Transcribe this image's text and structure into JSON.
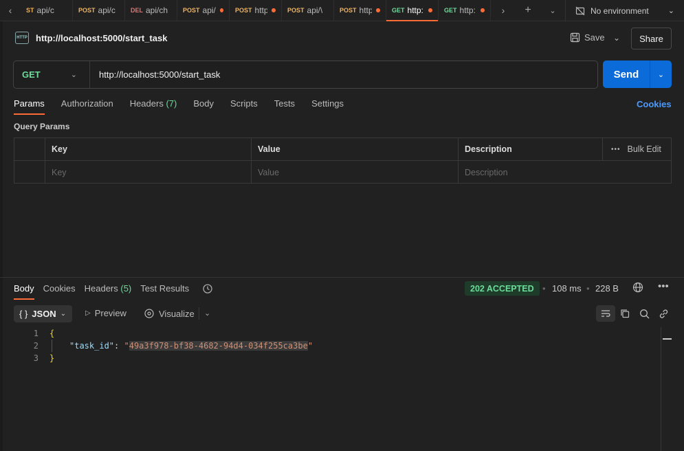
{
  "tabs": [
    {
      "method": "ST",
      "label": "api/c",
      "dot": false,
      "method_class": "m-post"
    },
    {
      "method": "POST",
      "label": "api/c",
      "dot": false,
      "method_class": "m-post"
    },
    {
      "method": "DEL",
      "label": "api/ch",
      "dot": false,
      "method_class": "m-del"
    },
    {
      "method": "POST",
      "label": "api/.",
      "dot": true,
      "method_class": "m-post"
    },
    {
      "method": "POST",
      "label": "http",
      "dot": true,
      "method_class": "m-post"
    },
    {
      "method": "POST",
      "label": "api/\\",
      "dot": false,
      "method_class": "m-post"
    },
    {
      "method": "POST",
      "label": "http",
      "dot": true,
      "method_class": "m-post"
    },
    {
      "method": "GET",
      "label": "http:,",
      "dot": true,
      "method_class": "m-get",
      "active": true
    },
    {
      "method": "GET",
      "label": "http:,",
      "dot": true,
      "method_class": "m-get"
    }
  ],
  "environment": {
    "label": "No environment"
  },
  "request": {
    "title": "http://localhost:5000/start_task",
    "save_label": "Save",
    "share_label": "Share",
    "method": "GET",
    "url": "http://localhost:5000/start_task",
    "send_label": "Send"
  },
  "request_tabs": {
    "params": "Params",
    "authorization": "Authorization",
    "headers": "Headers",
    "headers_count": "(7)",
    "body": "Body",
    "scripts": "Scripts",
    "tests": "Tests",
    "settings": "Settings",
    "cookies": "Cookies"
  },
  "query_params": {
    "label": "Query Params",
    "columns": {
      "key": "Key",
      "value": "Value",
      "description": "Description",
      "bulk_edit": "Bulk Edit"
    },
    "placeholders": {
      "key": "Key",
      "value": "Value",
      "description": "Description"
    }
  },
  "response": {
    "tabs": {
      "body": "Body",
      "cookies": "Cookies",
      "headers": "Headers",
      "headers_count": "(5)",
      "test_results": "Test Results"
    },
    "status": "202 ACCEPTED",
    "time": "108 ms",
    "size": "228 B",
    "format": "JSON",
    "preview_label": "Preview",
    "visualize_label": "Visualize",
    "code_lines": [
      {
        "num": "1",
        "type": "open",
        "text": "{"
      },
      {
        "num": "2",
        "type": "kv",
        "key": "\"task_id\"",
        "colon": ": ",
        "quote_open": "\"",
        "value": "49a3f978-bf38-4682-94d4-034f255ca3be",
        "quote_close": "\""
      },
      {
        "num": "3",
        "type": "close",
        "text": "}"
      }
    ]
  },
  "icons": {
    "http": "HTTP",
    "braces": "{ }"
  },
  "colors": {
    "accent": "#ff6c37",
    "send": "#0b6bd8",
    "get": "#6bdd9a",
    "post": "#f2b35d",
    "delete": "#e57373",
    "link": "#4b9bff"
  }
}
